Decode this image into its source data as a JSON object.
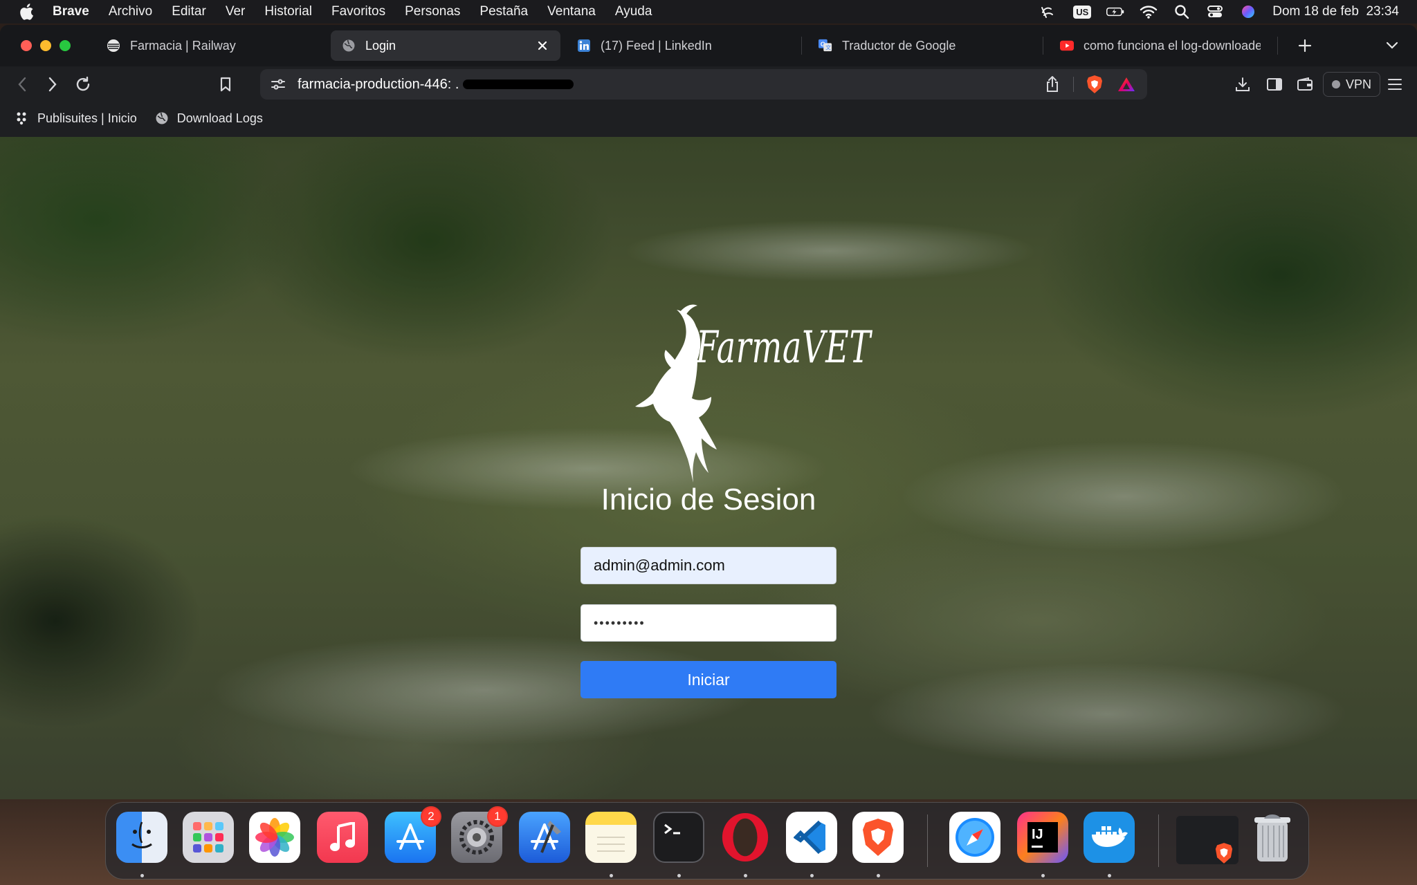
{
  "menubar": {
    "app": "Brave",
    "items": [
      "Archivo",
      "Editar",
      "Ver",
      "Historial",
      "Favoritos",
      "Personas",
      "Pestaña",
      "Ventana",
      "Ayuda"
    ],
    "input_source": "US",
    "clock": "Dom 18 de feb  23:34"
  },
  "tabs": [
    {
      "label": "Farmacia | Railway",
      "icon": "railway-icon"
    },
    {
      "label": "Login",
      "icon": "globe-icon",
      "active": true
    },
    {
      "label": "(17) Feed | LinkedIn",
      "icon": "linkedin-icon"
    },
    {
      "label": "Traductor de Google",
      "icon": "google-translate-icon"
    },
    {
      "label": "como funciona el log-downloader",
      "icon": "youtube-icon"
    }
  ],
  "toolbar": {
    "url": "farmacia-production-446: .",
    "vpn_label": "VPN"
  },
  "bookmarks": [
    {
      "label": "Publisuites | Inicio",
      "icon": "publisuites-icon"
    },
    {
      "label": "Download Logs",
      "icon": "globe-icon"
    }
  ],
  "login": {
    "brand": "FarmaVET",
    "title": "Inicio de Sesion",
    "email_value": "admin@admin.com",
    "password_value": "•••••••••",
    "submit_label": "Iniciar"
  },
  "dock": {
    "apps": [
      "Finder",
      "Launchpad",
      "Fotos",
      "Música",
      "App Store",
      "Configuración",
      "Xcode",
      "Notas",
      "Terminal",
      "Opera",
      "Visual Studio Code",
      "Brave",
      "Safari",
      "IntelliJ IDEA",
      "Docker",
      "Brave window",
      "Papelera"
    ],
    "app_store_badge": "2",
    "settings_badge": "1"
  },
  "colors": {
    "accent": "#2f7bf5",
    "tab_active": "#2e2f33",
    "email_autofill": "#e8f0fe"
  }
}
